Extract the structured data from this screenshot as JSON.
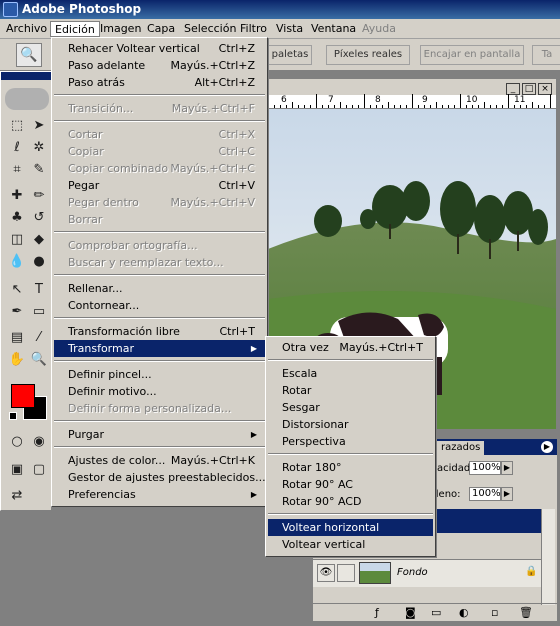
{
  "app": {
    "title": "Adobe Photoshop"
  },
  "menubar": {
    "items": [
      {
        "label": "Archivo"
      },
      {
        "label": "Edición"
      },
      {
        "label": "Imagen"
      },
      {
        "label": "Capa"
      },
      {
        "label": "Selección"
      },
      {
        "label": "Filtro"
      },
      {
        "label": "Vista"
      },
      {
        "label": "Ventana"
      },
      {
        "label": "Ayuda"
      }
    ]
  },
  "options": {
    "palettes_label": "paletas",
    "actual_pixels": "Píxeles reales",
    "fit_screen": "Encajar en pantalla",
    "print_size": "Ta"
  },
  "edit_menu": {
    "items": [
      {
        "label": "Rehacer Voltear vertical",
        "shortcut": "Ctrl+Z"
      },
      {
        "label": "Paso adelante",
        "shortcut": "Mayús.+Ctrl+Z"
      },
      {
        "label": "Paso atrás",
        "shortcut": "Alt+Ctrl+Z"
      },
      {
        "label": "Transición...",
        "shortcut": "Mayús.+Ctrl+F"
      },
      {
        "label": "Cortar",
        "shortcut": "Ctrl+X"
      },
      {
        "label": "Copiar",
        "shortcut": "Ctrl+C"
      },
      {
        "label": "Copiar combinado",
        "shortcut": "Mayús.+Ctrl+C"
      },
      {
        "label": "Pegar",
        "shortcut": "Ctrl+V"
      },
      {
        "label": "Pegar dentro",
        "shortcut": "Mayús.+Ctrl+V"
      },
      {
        "label": "Borrar",
        "shortcut": ""
      },
      {
        "label": "Comprobar ortografía...",
        "shortcut": ""
      },
      {
        "label": "Buscar y reemplazar texto...",
        "shortcut": ""
      },
      {
        "label": "Rellenar...",
        "shortcut": ""
      },
      {
        "label": "Contornear...",
        "shortcut": ""
      },
      {
        "label": "Transformación libre",
        "shortcut": "Ctrl+T"
      },
      {
        "label": "Transformar",
        "shortcut": ""
      },
      {
        "label": "Definir pincel...",
        "shortcut": ""
      },
      {
        "label": "Definir motivo...",
        "shortcut": ""
      },
      {
        "label": "Definir forma personalizada...",
        "shortcut": ""
      },
      {
        "label": "Purgar",
        "shortcut": ""
      },
      {
        "label": "Ajustes de color...",
        "shortcut": "Mayús.+Ctrl+K"
      },
      {
        "label": "Gestor de ajustes preestablecidos...",
        "shortcut": ""
      },
      {
        "label": "Preferencias",
        "shortcut": ""
      }
    ]
  },
  "transform_menu": {
    "items": [
      {
        "label": "Otra vez",
        "shortcut": "Mayús.+Ctrl+T"
      },
      {
        "label": "Escala"
      },
      {
        "label": "Rotar"
      },
      {
        "label": "Sesgar"
      },
      {
        "label": "Distorsionar"
      },
      {
        "label": "Perspectiva"
      },
      {
        "label": "Rotar 180°"
      },
      {
        "label": "Rotar 90° AC"
      },
      {
        "label": "Rotar 90° ACD"
      },
      {
        "label": "Voltear horizontal"
      },
      {
        "label": "Voltear vertical"
      }
    ]
  },
  "ruler": {
    "labels": [
      "6",
      "7",
      "8",
      "9",
      "10",
      "11"
    ]
  },
  "layers_panel": {
    "tab_label": "razados",
    "opacity_label": "acidad:",
    "opacity_value": "100%",
    "fill_label": "lleno:",
    "fill_value": "100%",
    "layer_name": "Fondo"
  },
  "colors": {
    "accent": "#0a246a",
    "foreground": "#ff0000",
    "background": "#000000"
  }
}
